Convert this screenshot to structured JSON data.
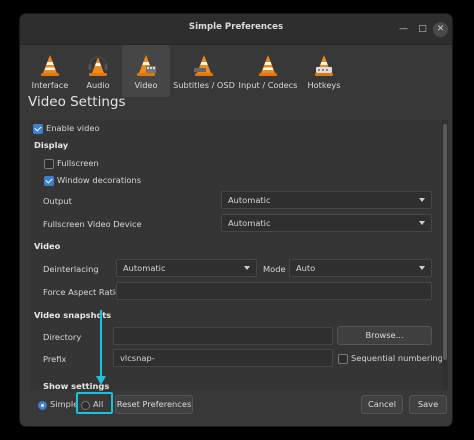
{
  "window": {
    "title": "Simple Preferences"
  },
  "toolbar": {
    "items": [
      {
        "label": "Interface",
        "icon": "cone-interface-icon"
      },
      {
        "label": "Audio",
        "icon": "cone-headphones-icon"
      },
      {
        "label": "Video",
        "icon": "cone-video-icon",
        "active": true
      },
      {
        "label": "Subtitles / OSD",
        "icon": "cone-subtitles-icon"
      },
      {
        "label": "Input / Codecs",
        "icon": "cone-input-icon"
      },
      {
        "label": "Hotkeys",
        "icon": "cone-hotkeys-icon"
      }
    ]
  },
  "page": {
    "title": "Video Settings"
  },
  "settings": {
    "enable_video": {
      "label": "Enable video",
      "checked": true
    },
    "display": {
      "heading": "Display",
      "fullscreen": {
        "label": "Fullscreen",
        "checked": false
      },
      "window_decorations": {
        "label": "Window decorations",
        "checked": true
      },
      "output": {
        "label": "Output",
        "value": "Automatic"
      },
      "fullscreen_device": {
        "label": "Fullscreen Video Device",
        "value": "Automatic"
      }
    },
    "video": {
      "heading": "Video",
      "deinterlacing": {
        "label": "Deinterlacing",
        "value": "Automatic"
      },
      "mode": {
        "label": "Mode",
        "value": "Auto"
      },
      "aspect_ratio": {
        "label": "Force Aspect Ratio",
        "value": ""
      }
    },
    "snapshots": {
      "heading": "Video snapshots",
      "directory": {
        "label": "Directory",
        "value": "",
        "browse": "Browse..."
      },
      "prefix": {
        "label": "Prefix",
        "value": "vlcsnap-"
      },
      "sequential": {
        "label": "Sequential numbering",
        "checked": false
      }
    }
  },
  "footer": {
    "show_settings": "Show settings",
    "simple": "Simple",
    "all": "All",
    "selected": "Simple",
    "reset": "Reset Preferences",
    "cancel": "Cancel",
    "save": "Save"
  },
  "colors": {
    "accent": "#3d7fd0",
    "annotation": "#19c3d9",
    "window_bg": "#383838"
  }
}
